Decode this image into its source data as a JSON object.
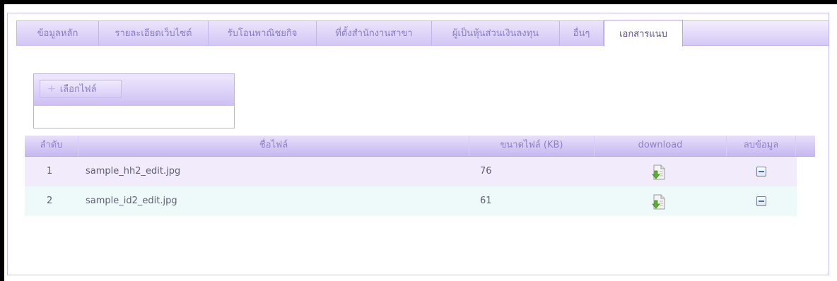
{
  "tabs": [
    {
      "label": "ข้อมูลหลัก",
      "active": false
    },
    {
      "label": "รายละเอียดเว็บไซต์",
      "active": false
    },
    {
      "label": "รับโอนพาณิชยกิจ",
      "active": false
    },
    {
      "label": "ที่ตั้งสำนักงานสาขา",
      "active": false
    },
    {
      "label": "ผู้เป็นหุ้นส่วนเงินลงทุน",
      "active": false
    },
    {
      "label": "อื่นๆ",
      "active": false
    },
    {
      "label": "เอกสารแนบ",
      "active": true
    }
  ],
  "uploader": {
    "select_label": "เลือกไฟล์",
    "plus_icon": "plus-icon"
  },
  "table": {
    "headers": {
      "index": "ลำดับ",
      "filename": "ชื่อไฟล์",
      "size": "ขนาดไฟล์ (KB)",
      "download": "download",
      "delete": "ลบข้อมูล"
    },
    "rows": [
      {
        "index": "1",
        "filename": "sample_hh2_edit.jpg",
        "size": "76",
        "download_icon": "download-file-icon",
        "delete_icon": "minus-icon"
      },
      {
        "index": "2",
        "filename": "sample_id2_edit.jpg",
        "size": "61",
        "download_icon": "download-file-icon",
        "delete_icon": "minus-icon"
      }
    ]
  },
  "colors": {
    "tab_text": "#8a7cc6",
    "active_tab_text": "#5a4aa0",
    "row_odd": "#f1ebfb",
    "row_even": "#eef9f9",
    "download_arrow": "#5bb030"
  }
}
